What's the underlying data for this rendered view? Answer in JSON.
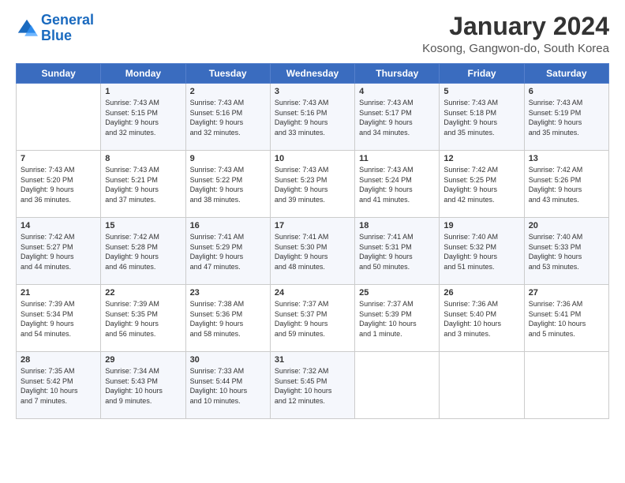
{
  "header": {
    "logo_general": "General",
    "logo_blue": "Blue",
    "month_title": "January 2024",
    "location": "Kosong, Gangwon-do, South Korea"
  },
  "days_of_week": [
    "Sunday",
    "Monday",
    "Tuesday",
    "Wednesday",
    "Thursday",
    "Friday",
    "Saturday"
  ],
  "weeks": [
    [
      {
        "day": "",
        "info": ""
      },
      {
        "day": "1",
        "info": "Sunrise: 7:43 AM\nSunset: 5:15 PM\nDaylight: 9 hours\nand 32 minutes."
      },
      {
        "day": "2",
        "info": "Sunrise: 7:43 AM\nSunset: 5:16 PM\nDaylight: 9 hours\nand 32 minutes."
      },
      {
        "day": "3",
        "info": "Sunrise: 7:43 AM\nSunset: 5:16 PM\nDaylight: 9 hours\nand 33 minutes."
      },
      {
        "day": "4",
        "info": "Sunrise: 7:43 AM\nSunset: 5:17 PM\nDaylight: 9 hours\nand 34 minutes."
      },
      {
        "day": "5",
        "info": "Sunrise: 7:43 AM\nSunset: 5:18 PM\nDaylight: 9 hours\nand 35 minutes."
      },
      {
        "day": "6",
        "info": "Sunrise: 7:43 AM\nSunset: 5:19 PM\nDaylight: 9 hours\nand 35 minutes."
      }
    ],
    [
      {
        "day": "7",
        "info": "Sunrise: 7:43 AM\nSunset: 5:20 PM\nDaylight: 9 hours\nand 36 minutes."
      },
      {
        "day": "8",
        "info": "Sunrise: 7:43 AM\nSunset: 5:21 PM\nDaylight: 9 hours\nand 37 minutes."
      },
      {
        "day": "9",
        "info": "Sunrise: 7:43 AM\nSunset: 5:22 PM\nDaylight: 9 hours\nand 38 minutes."
      },
      {
        "day": "10",
        "info": "Sunrise: 7:43 AM\nSunset: 5:23 PM\nDaylight: 9 hours\nand 39 minutes."
      },
      {
        "day": "11",
        "info": "Sunrise: 7:43 AM\nSunset: 5:24 PM\nDaylight: 9 hours\nand 41 minutes."
      },
      {
        "day": "12",
        "info": "Sunrise: 7:42 AM\nSunset: 5:25 PM\nDaylight: 9 hours\nand 42 minutes."
      },
      {
        "day": "13",
        "info": "Sunrise: 7:42 AM\nSunset: 5:26 PM\nDaylight: 9 hours\nand 43 minutes."
      }
    ],
    [
      {
        "day": "14",
        "info": "Sunrise: 7:42 AM\nSunset: 5:27 PM\nDaylight: 9 hours\nand 44 minutes."
      },
      {
        "day": "15",
        "info": "Sunrise: 7:42 AM\nSunset: 5:28 PM\nDaylight: 9 hours\nand 46 minutes."
      },
      {
        "day": "16",
        "info": "Sunrise: 7:41 AM\nSunset: 5:29 PM\nDaylight: 9 hours\nand 47 minutes."
      },
      {
        "day": "17",
        "info": "Sunrise: 7:41 AM\nSunset: 5:30 PM\nDaylight: 9 hours\nand 48 minutes."
      },
      {
        "day": "18",
        "info": "Sunrise: 7:41 AM\nSunset: 5:31 PM\nDaylight: 9 hours\nand 50 minutes."
      },
      {
        "day": "19",
        "info": "Sunrise: 7:40 AM\nSunset: 5:32 PM\nDaylight: 9 hours\nand 51 minutes."
      },
      {
        "day": "20",
        "info": "Sunrise: 7:40 AM\nSunset: 5:33 PM\nDaylight: 9 hours\nand 53 minutes."
      }
    ],
    [
      {
        "day": "21",
        "info": "Sunrise: 7:39 AM\nSunset: 5:34 PM\nDaylight: 9 hours\nand 54 minutes."
      },
      {
        "day": "22",
        "info": "Sunrise: 7:39 AM\nSunset: 5:35 PM\nDaylight: 9 hours\nand 56 minutes."
      },
      {
        "day": "23",
        "info": "Sunrise: 7:38 AM\nSunset: 5:36 PM\nDaylight: 9 hours\nand 58 minutes."
      },
      {
        "day": "24",
        "info": "Sunrise: 7:37 AM\nSunset: 5:37 PM\nDaylight: 9 hours\nand 59 minutes."
      },
      {
        "day": "25",
        "info": "Sunrise: 7:37 AM\nSunset: 5:39 PM\nDaylight: 10 hours\nand 1 minute."
      },
      {
        "day": "26",
        "info": "Sunrise: 7:36 AM\nSunset: 5:40 PM\nDaylight: 10 hours\nand 3 minutes."
      },
      {
        "day": "27",
        "info": "Sunrise: 7:36 AM\nSunset: 5:41 PM\nDaylight: 10 hours\nand 5 minutes."
      }
    ],
    [
      {
        "day": "28",
        "info": "Sunrise: 7:35 AM\nSunset: 5:42 PM\nDaylight: 10 hours\nand 7 minutes."
      },
      {
        "day": "29",
        "info": "Sunrise: 7:34 AM\nSunset: 5:43 PM\nDaylight: 10 hours\nand 9 minutes."
      },
      {
        "day": "30",
        "info": "Sunrise: 7:33 AM\nSunset: 5:44 PM\nDaylight: 10 hours\nand 10 minutes."
      },
      {
        "day": "31",
        "info": "Sunrise: 7:32 AM\nSunset: 5:45 PM\nDaylight: 10 hours\nand 12 minutes."
      },
      {
        "day": "",
        "info": ""
      },
      {
        "day": "",
        "info": ""
      },
      {
        "day": "",
        "info": ""
      }
    ]
  ]
}
